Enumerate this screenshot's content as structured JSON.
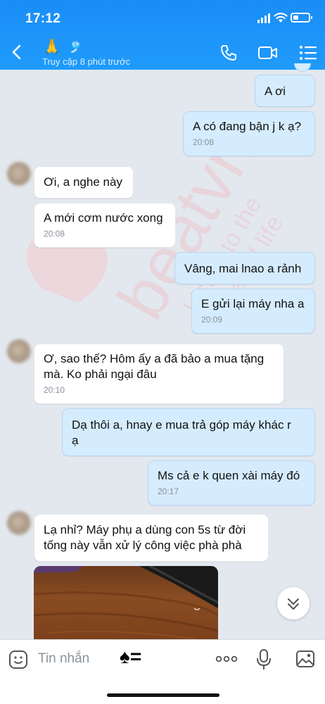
{
  "status_bar": {
    "time": "17:12"
  },
  "header": {
    "contact_name_emoji": "🙏",
    "contact_name_symbol": "🎐",
    "last_seen": "Truy cập 8 phút trước"
  },
  "watermark": {
    "brand": "beatvn",
    "tagline1": "Listen to the",
    "tagline2": "beat of life"
  },
  "messages": [
    {
      "side": "out",
      "text": "A ơi",
      "time": ""
    },
    {
      "side": "out",
      "text": "A có đang bận j k ạ?",
      "time": "20:08"
    },
    {
      "side": "in",
      "text": "Ơi, a nghe này",
      "time": ""
    },
    {
      "side": "in",
      "text": "A mới cơm nước xong",
      "time": "20:08"
    },
    {
      "side": "out",
      "text": "Vâng, mai lnao a rảnh",
      "time": ""
    },
    {
      "side": "out",
      "text": "E gửi lại máy nha a",
      "time": "20:09"
    },
    {
      "side": "in",
      "text_line1": "Ơ, sao thế? Hôm ấy a đã bảo a mua tặng",
      "text_line2": "mà. Ko phải ngại đâu",
      "time": "20:10"
    },
    {
      "side": "out",
      "text_line1": "Dạ thôi a, hnay e mua trả góp máy khác r",
      "text_line2": "ạ",
      "time": ""
    },
    {
      "side": "out",
      "text": "Ms cả e k quen xài máy đó",
      "time": "20:17"
    },
    {
      "side": "in",
      "text_line1": "Lạ nhỉ? Máy phụ a dùng con 5s từ đời",
      "text_line2": "tống này vẫn xử lý công việc phà phà",
      "time": ""
    }
  ],
  "composer": {
    "placeholder": "Tin nhắn",
    "sticker_label": "♠="
  },
  "colors": {
    "header_blue": "#1f9bfb",
    "outgoing_bubble": "#d5ecff",
    "incoming_bubble": "#ffffff",
    "chat_bg": "#e3e8ef"
  }
}
